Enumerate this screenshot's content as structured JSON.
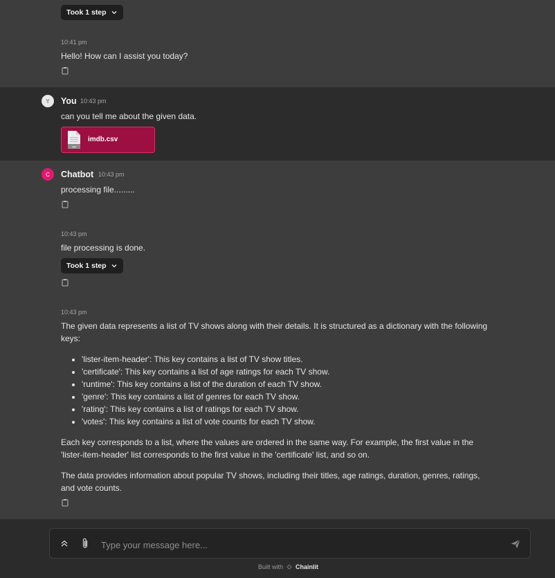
{
  "messages": {
    "m0": {
      "step_label": "Took 1 step"
    },
    "m1": {
      "time": "10:41 pm",
      "text": "Hello! How can I assist you today?"
    },
    "m2": {
      "avatar_letter": "Y",
      "author": "You",
      "time": "10:43 pm",
      "text": "can you tell me about the given data.",
      "file_name": "imdb.csv",
      "file_icon_caption": "csv"
    },
    "m3": {
      "avatar_letter": "C",
      "author": "Chatbot",
      "time": "10:43 pm",
      "text": "processing file........."
    },
    "m4": {
      "time": "10:43 pm",
      "text": "file processing is done.",
      "step_label": "Took 1 step"
    },
    "m5": {
      "time": "10:43 pm",
      "intro_line1": "The given data represents a list of TV shows along with their details. It is structured as a dictionary with the following",
      "intro_line2": "keys:",
      "bullets": [
        "'lister-item-header': This key contains a list of TV show titles.",
        "'certificate': This key contains a list of age ratings for each TV show.",
        "'runtime': This key contains a list of the duration of each TV show.",
        "'genre': This key contains a list of genres for each TV show.",
        "'rating': This key contains a list of ratings for each TV show.",
        "'votes': This key contains a list of vote counts for each TV show."
      ],
      "para2_line1": "Each key corresponds to a list, where the values are ordered in the same way. For example, the first value in the",
      "para2_line2": "'lister-item-header' list corresponds to the first value in the 'certificate' list, and so on.",
      "para3_line1": "The data provides information about popular TV shows, including their titles, age ratings, duration, genres, ratings,",
      "para3_line2": "and vote counts."
    }
  },
  "composer": {
    "placeholder": "Type your message here..."
  },
  "footer": {
    "built_with": "Built with",
    "brand": "Chainlit"
  },
  "icons": {
    "expand": "chevrons-up-icon",
    "attach": "paperclip-icon",
    "send": "send-icon",
    "copy": "clipboard-icon",
    "step": "chevron-down-icon"
  },
  "colors": {
    "bot_avatar": "#e4176f",
    "file_chip": "#9c0f40",
    "user_bg": "#2c2c2c",
    "bot_bg": "#3d3d3d"
  }
}
